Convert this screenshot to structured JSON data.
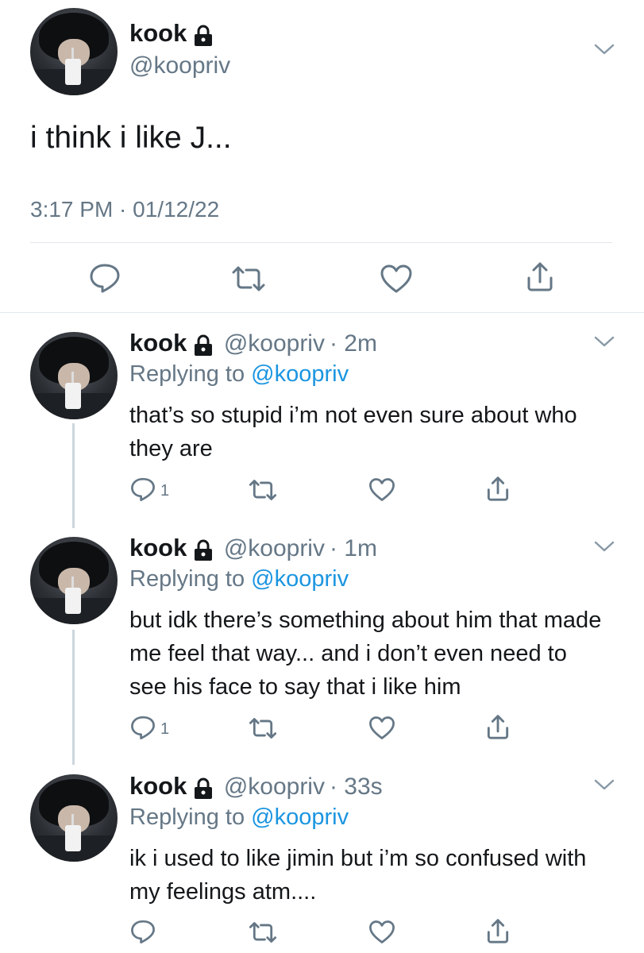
{
  "main_tweet": {
    "name": "kook",
    "handle": "@koopriv",
    "text": "i think i like J...",
    "timestamp": "3:17 PM · 01/12/22"
  },
  "replies": [
    {
      "name": "kook",
      "handle": "@koopriv",
      "time": "· 2m",
      "replying_prefix": "Replying to",
      "replying_to": "@koopriv",
      "text": "that’s so stupid i’m not even sure about who they are",
      "reply_count": "1"
    },
    {
      "name": "kook",
      "handle": "@koopriv",
      "time": "· 1m",
      "replying_prefix": "Replying to",
      "replying_to": "@koopriv",
      "text": "but idk there’s something about him that made me feel that way... and i don’t even need to see his face to say that i like him",
      "reply_count": "1"
    },
    {
      "name": "kook",
      "handle": "@koopriv",
      "time": "· 33s",
      "replying_prefix": "Replying to",
      "replying_to": "@koopriv",
      "text": "ik i used to like jimin but i’m so confused with my feelings atm....",
      "reply_count": ""
    }
  ],
  "icons": [
    "lock-icon",
    "chevron-down-icon",
    "reply-icon",
    "retweet-icon",
    "like-icon",
    "share-icon"
  ],
  "colors": {
    "text": "#14171a",
    "secondary": "#657786",
    "link": "#1b95e0",
    "divider": "#e1e8ed"
  }
}
